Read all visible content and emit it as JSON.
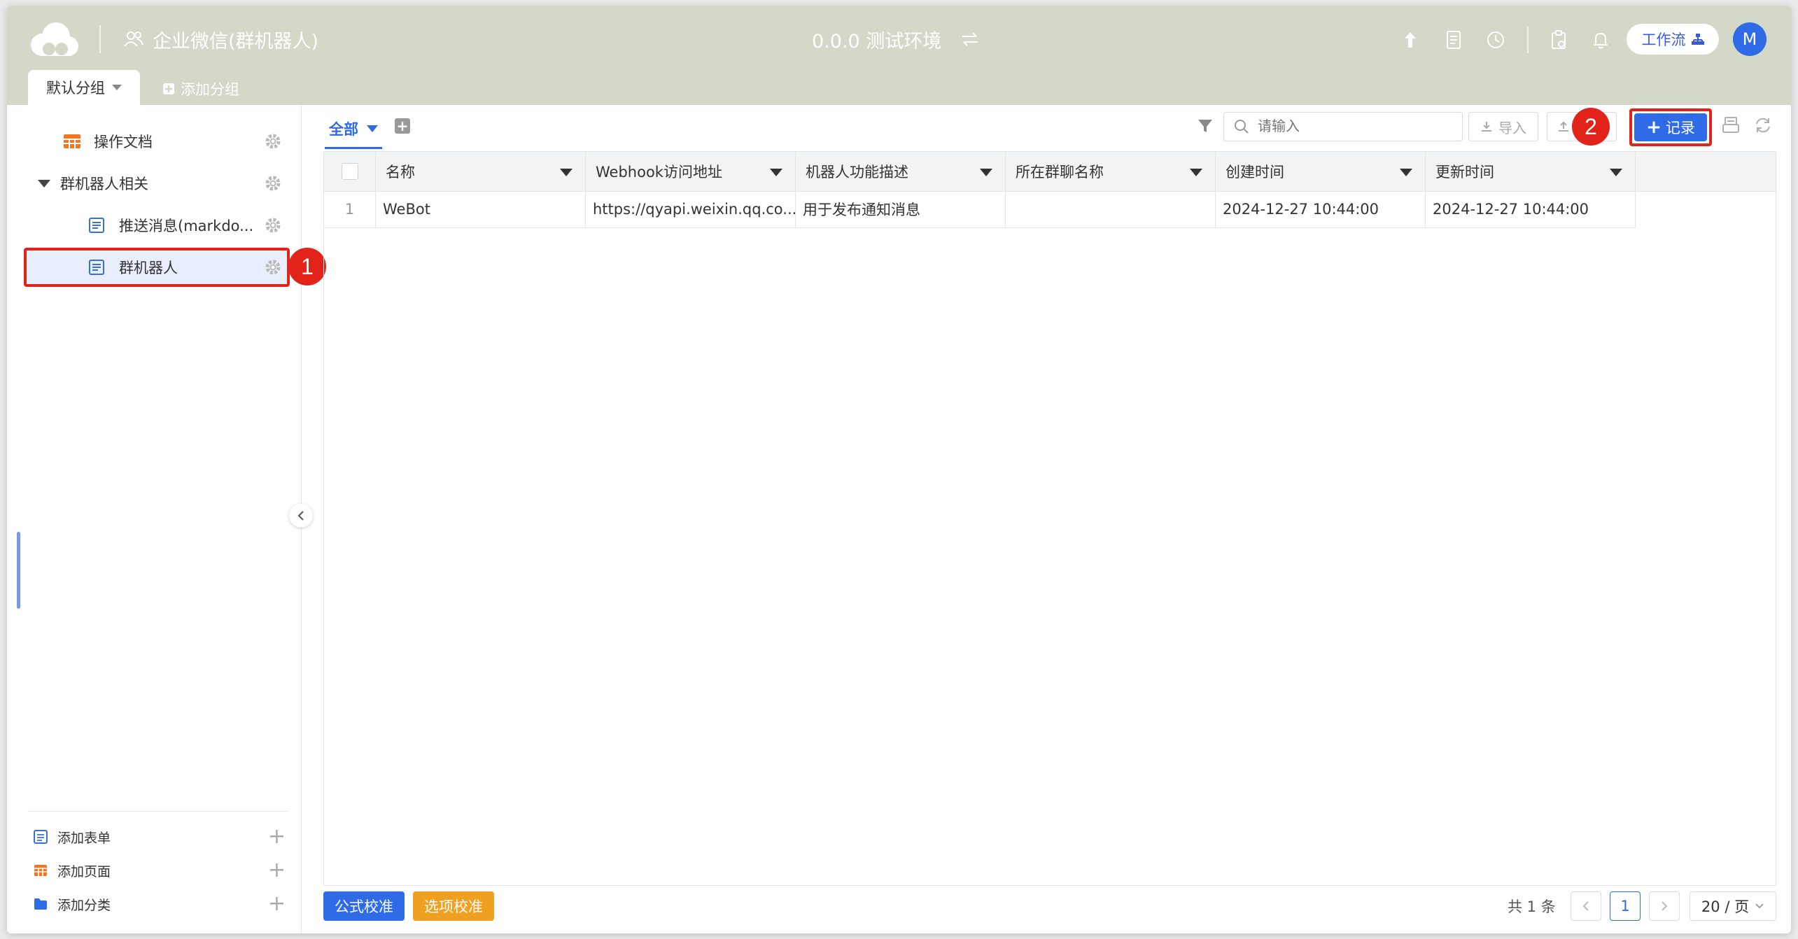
{
  "header": {
    "app_name": "企业微信(群机器人)",
    "env_name": "0.0.0 测试环境",
    "workflow_label": "工作流",
    "avatar_initial": "M"
  },
  "groups": {
    "active": "默认分组",
    "add": "添加分组"
  },
  "sidebar": {
    "items": [
      {
        "label": "操作文档",
        "icon": "sheet-icon"
      },
      {
        "label": "群机器人相关",
        "icon": "caret-down-icon"
      },
      {
        "label": "推送消息(markdo...",
        "icon": "form-icon"
      },
      {
        "label": "群机器人",
        "icon": "form-icon"
      }
    ],
    "footer": [
      {
        "label": "添加表单",
        "icon": "form-icon"
      },
      {
        "label": "添加页面",
        "icon": "sheet-icon"
      },
      {
        "label": "添加分类",
        "icon": "folder-icon"
      }
    ]
  },
  "annotations": {
    "badge1": "1",
    "badge2": "2"
  },
  "toolbar": {
    "view_tab": "全部",
    "search_placeholder": "请输入",
    "import_label": "导入",
    "add_record_label": "记录"
  },
  "table": {
    "columns": [
      "名称",
      "Webhook访问地址",
      "机器人功能描述",
      "所在群聊名称",
      "创建时间",
      "更新时间"
    ],
    "rows": [
      {
        "index": "1",
        "cells": [
          "WeBot",
          "https://qyapi.weixin.qq.co...",
          "用于发布通知消息",
          "",
          "2024-12-27 10:44:00",
          "2024-12-27 10:44:00"
        ]
      }
    ]
  },
  "footer": {
    "formula_check": "公式校准",
    "option_check": "选项校准",
    "total": "共 1 条",
    "page": "1",
    "page_size": "20 / 页"
  },
  "colors": {
    "header_bg": "#d4d8c9",
    "accent": "#2f6be6",
    "highlight": "#e2231a",
    "option_btn": "#f0a020"
  }
}
